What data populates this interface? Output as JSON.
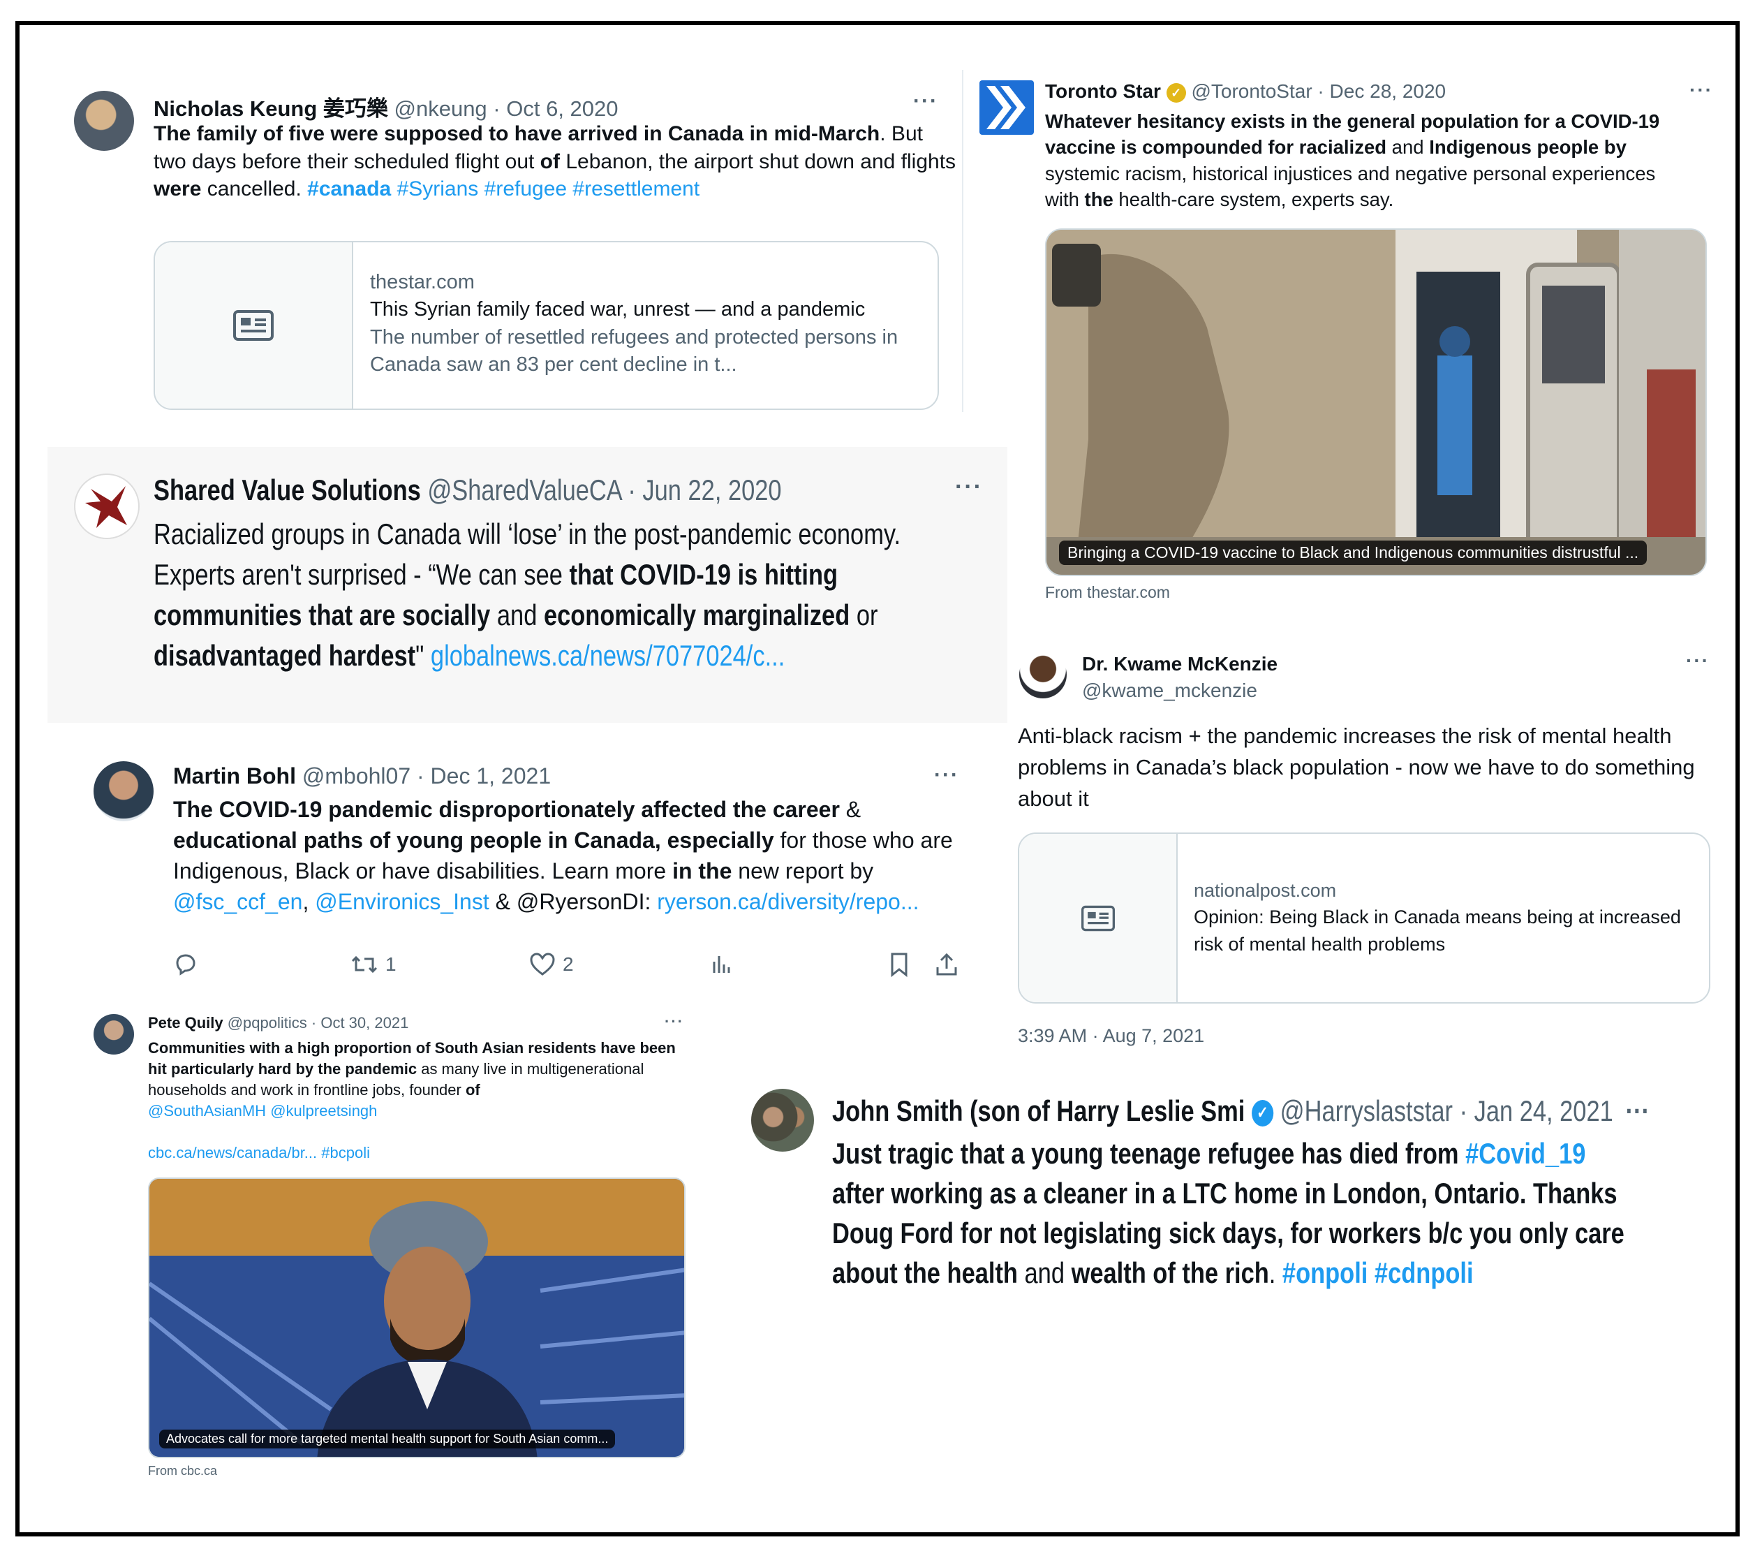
{
  "tweets": {
    "keung": {
      "name": "Nicholas Keung 姜巧樂",
      "handle": "@nkeung",
      "date": "Oct 6, 2020",
      "more": "···",
      "t1": "The family of five were supposed to have arrived in Canada in mid-March",
      "t2": ". But two days before their scheduled flight out ",
      "t3": "of",
      "t4": " Lebanon, the airport shut down and flights ",
      "t5": "were",
      "t6": " cancelled. ",
      "tags": [
        "#canada",
        "#Syrians",
        "#refugee",
        "#resettlement"
      ],
      "card": {
        "domain": "thestar.com",
        "title": "This Syrian family faced war, unrest — and a pandemic",
        "desc": "The number of resettled refugees and protected persons in Canada saw an 83 per cent decline in t..."
      }
    },
    "star": {
      "name": "Toronto Star",
      "handle": "@TorontoStar",
      "date": "Dec 28, 2020",
      "more": "···",
      "t1": "Whatever hesitancy exists in the general population for a COVID-19 vaccine is compounded for racialized",
      "t2": " and ",
      "t3": "Indigenous people by",
      "t4": " systemic racism, historical injustices and negative personal experiences with ",
      "t5": "the",
      "t6": " health-care system, experts say.",
      "caption": "Bringing a COVID-19 vaccine to Black and Indigenous communities distrustful ...",
      "source": "From thestar.com"
    },
    "svs": {
      "name": "Shared Value Solutions",
      "handle": "@SharedValueCA",
      "date": "Jun 22, 2020",
      "more": "···",
      "t1": "Racialized groups in Canada will ‘lose’ in the post-pandemic economy. Experts aren't surprised - “We can see ",
      "t2": "that COVID-19 is hitting communities that are socially",
      "t3": " and ",
      "t4": "economically marginalized",
      "t5": " or ",
      "t6": "disadvantaged hardest",
      "t7": "\" ",
      "link": "globalnews.ca/news/7077024/c..."
    },
    "mckenzie": {
      "name": "Dr. Kwame McKenzie",
      "handle": "@kwame_mckenzie",
      "more": "···",
      "text": "Anti-black racism + the pandemic increases the risk of mental health problems in Canada’s black population - now we have to do something about it",
      "card": {
        "domain": "nationalpost.com",
        "title": "Opinion: Being Black in Canada means being at increased risk of mental health problems"
      },
      "timestamp": "3:39 AM · Aug 7, 2021"
    },
    "bohl": {
      "name": "Martin Bohl",
      "handle": "@mbohl07",
      "date": "Dec 1, 2021",
      "more": "···",
      "t1": "The COVID-19 pandemic disproportionately affected the career",
      "t2": " & ",
      "t3": "educational paths of young people in Canada, especially",
      "t4": " for those who are Indigenous, Black or have disabilities. Learn more ",
      "t5": "in the",
      "t6": " new report by ",
      "m1": "@fsc_ccf_en",
      "t7": ", ",
      "m2": "@Environics_Inst",
      "t8": " & @RyersonDI: ",
      "link": "ryerson.ca/diversity/repo...",
      "retweets": "1",
      "likes": "2"
    },
    "quily": {
      "name": "Pete Quily",
      "handle": "@pqpolitics",
      "date": "Oct 30, 2021",
      "more": "···",
      "t1": "Communities with a high proportion of South Asian residents have been hit particularly hard by the pandemic",
      "t2": " as many live in multigenerational households and work in frontline jobs, founder ",
      "t3": "of",
      "m1": "@SouthAsianMH",
      "m2": "@kulpreetsingh",
      "link": "cbc.ca/news/canada/br...",
      "tag": "#bcpoli",
      "caption": "Advocates call for more targeted mental health support for South Asian comm...",
      "source": "From cbc.ca"
    },
    "smith": {
      "name": "John Smith (son of Harry Leslie Smi",
      "handle": "@Harryslaststar",
      "date": "Jan 24, 2021",
      "more": "···",
      "t1": "Just tragic that a young teenage refugee has died from ",
      "tag1": "#Covid_19",
      "t2": " after working as a cleaner in a LTC home in London, Ontario. Thanks Doug Ford for not legislating  sick days, for workers b/c you only care about the health",
      "t3": " and ",
      "t4": "wealth of the rich",
      "t5": ". ",
      "tag2": "#onpoli",
      "tag3": "#cdnpoli"
    }
  },
  "separator": " · ",
  "verified_mark": "✓",
  "colors": {
    "link": "#1d9bf0",
    "muted": "#536471",
    "gold": "#e2b719",
    "star_blue": "#1d6fd6",
    "svs_red": "#8b1a1a"
  }
}
